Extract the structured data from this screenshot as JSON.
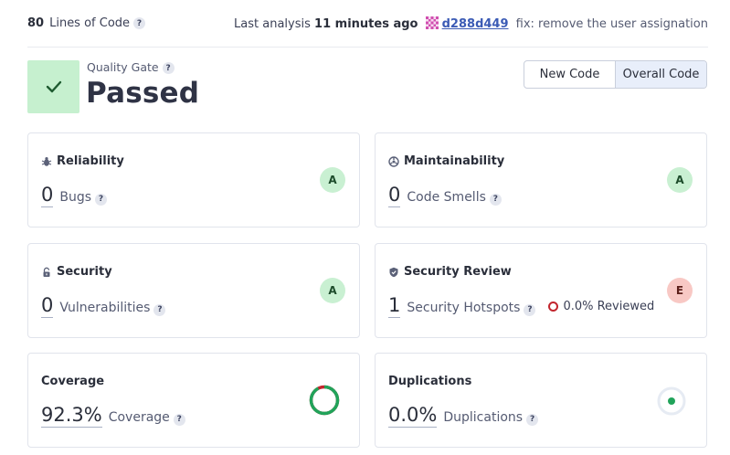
{
  "header": {
    "lines_count": "80",
    "lines_label": "Lines of Code",
    "last_analysis_label": "Last analysis",
    "last_analysis_time": "11 minutes ago",
    "commit_hash": "d288d449",
    "commit_message": "fix: remove the user assignation"
  },
  "quality_gate": {
    "label": "Quality Gate",
    "status": "Passed"
  },
  "code_toggle": {
    "new_code": "New Code",
    "overall_code": "Overall Code",
    "selected": "Overall Code"
  },
  "cards": {
    "reliability": {
      "title": "Reliability",
      "value": "0",
      "label": "Bugs",
      "rating": "A"
    },
    "maintainability": {
      "title": "Maintainability",
      "value": "0",
      "label": "Code Smells",
      "rating": "A"
    },
    "security": {
      "title": "Security",
      "value": "0",
      "label": "Vulnerabilities",
      "rating": "A"
    },
    "security_review": {
      "title": "Security Review",
      "value": "1",
      "label": "Security Hotspots",
      "reviewed": "0.0% Reviewed",
      "rating": "E"
    },
    "coverage": {
      "title": "Coverage",
      "value": "92.3%",
      "label": "Coverage",
      "percent": 92.3
    },
    "duplications": {
      "title": "Duplications",
      "value": "0.0%",
      "label": "Duplications",
      "percent": 0.0
    }
  },
  "help_glyph": "?",
  "colors": {
    "passed_bg": "#c6f0cf",
    "rating_a": "#c9f0d2",
    "rating_e": "#f8c8c4",
    "coverage_green": "#21a35a",
    "coverage_red": "#c2262e",
    "commit_link": "#3b5bb5"
  },
  "icons": [
    "help-icon",
    "commit-identicon",
    "check-icon",
    "bug-icon",
    "maintainability-icon",
    "lock-icon",
    "shield-icon",
    "coverage-donut",
    "duplications-indicator"
  ]
}
